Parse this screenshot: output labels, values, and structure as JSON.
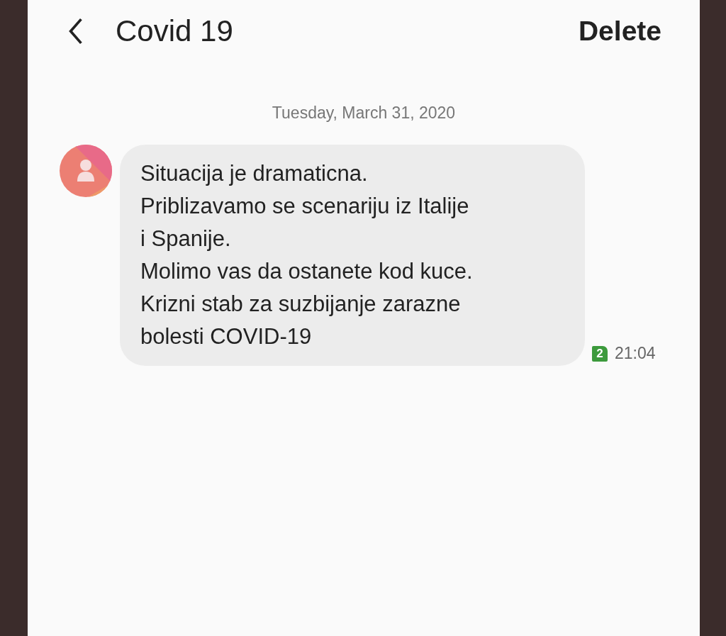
{
  "header": {
    "title": "Covid 19",
    "action": "Delete"
  },
  "date": "Tuesday, March 31, 2020",
  "messages": [
    {
      "text": "Situacija je dramaticna.\nPriblizavamo se scenariju iz Italije\ni Spanije.\nMolimo vas da ostanete kod kuce.\nKrizni stab za suzbijanje zarazne\nbolesti COVID-19",
      "sim": "2",
      "time": "21:04"
    }
  ]
}
